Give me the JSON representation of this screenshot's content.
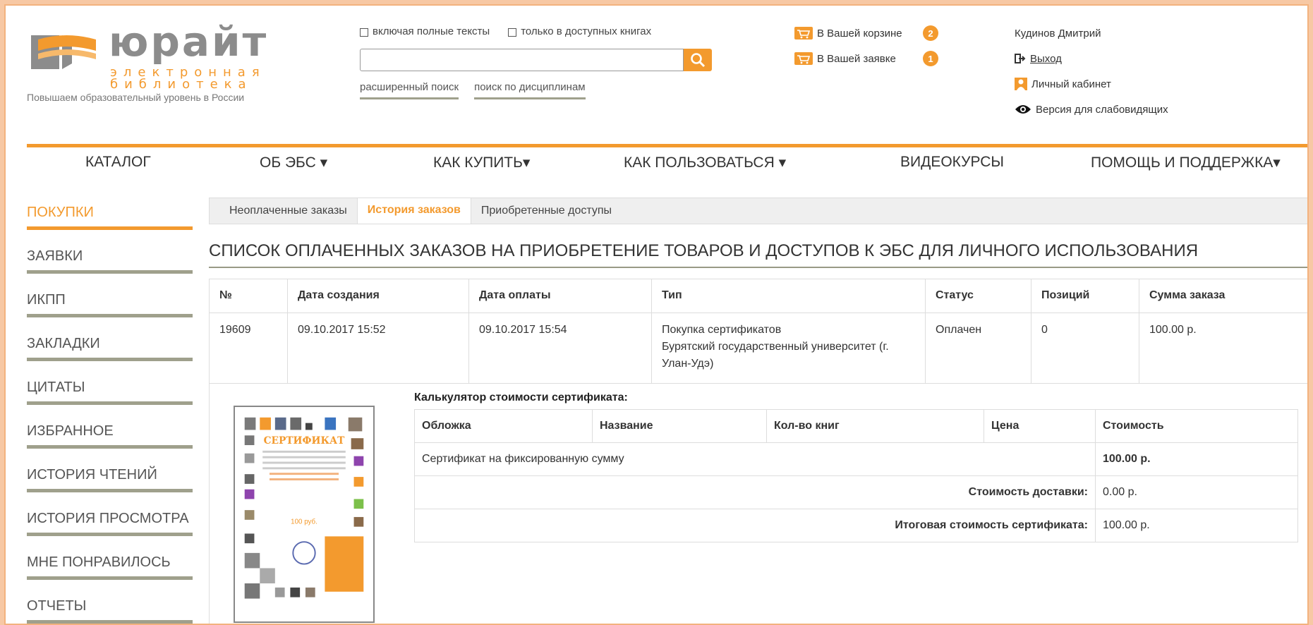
{
  "header": {
    "logo_word": "юрайт",
    "logo_sub_line1": "электронная",
    "logo_sub_line2": "библиотека",
    "tagline": "Повышаем образовательный уровень в России"
  },
  "search": {
    "check_full_texts": "включая полные тексты",
    "check_available": "только в доступных книгах",
    "placeholder": "",
    "advanced_link": "расширенный поиск",
    "discipline_link": "поиск по дисциплинам"
  },
  "basket": {
    "cart_label": "В Вашей корзине",
    "cart_count": "2",
    "request_label": "В Вашей заявке",
    "request_count": "1"
  },
  "user": {
    "name": "Кудинов Дмитрий",
    "logout": "Выход",
    "cabinet": "Личный кабинет",
    "low_vision": "Версия для слабовидящих"
  },
  "nav": {
    "catalog": "КАТАЛОГ",
    "about": "ОБ ЭБС ▾",
    "how_buy": "КАК КУПИТЬ▾",
    "how_use": "КАК ПОЛЬЗОВАТЬСЯ ▾",
    "video": "ВИДЕОКУРСЫ",
    "help": "ПОМОЩЬ И ПОДДЕРЖКА▾"
  },
  "sidebar": {
    "items": [
      "ПОКУПКИ",
      "ЗАЯВКИ",
      "ИКПП",
      "ЗАКЛАДКИ",
      "ЦИТАТЫ",
      "ИЗБРАННОЕ",
      "ИСТОРИЯ ЧТЕНИЙ",
      "ИСТОРИЯ ПРОСМОТРА",
      "МНЕ ПОНРАВИЛОСЬ",
      "ОТЧЕТЫ"
    ]
  },
  "tabs": {
    "unpaid": "Неоплаченные заказы",
    "history": "История заказов",
    "acquired": "Приобретенные доступы"
  },
  "page_title": "СПИСОК ОПЛАЧЕННЫХ ЗАКАЗОВ НА ПРИОБРЕТЕНИЕ ТОВАРОВ И ДОСТУПОВ К ЭБС ДЛЯ ЛИЧНОГО ИСПОЛЬЗОВАНИЯ",
  "orders": {
    "headers": [
      "№",
      "Дата создания",
      "Дата оплаты",
      "Тип",
      "Статус",
      "Позиций",
      "Сумма заказа"
    ],
    "row": {
      "number": "19609",
      "created": "09.10.2017 15:52",
      "paid": "09.10.2017 15:54",
      "type_line1": "Покупка сертификатов",
      "type_line2": "Бурятский государственный университет (г. Улан-Удэ)",
      "status": "Оплачен",
      "positions": "0",
      "sum": "100.00 р."
    }
  },
  "calculator": {
    "title": "Калькулятор стоимости сертификата:",
    "headers": [
      "Обложка",
      "Название",
      "Кол-во книг",
      "Цена",
      "Стоимость"
    ],
    "item_name": "Сертификат на фиксированную сумму",
    "item_cost": "100.00 р.",
    "delivery_label": "Стоимость доставки:",
    "delivery_value": "0.00 р.",
    "total_label": "Итоговая стоимость сертификата:",
    "total_value": "100.00 р."
  },
  "certificate": {
    "heading": "СЕРТИФИКАТ",
    "amount": "100 руб."
  },
  "colors": {
    "accent": "#f39a2e",
    "underline": "#9fa08c"
  }
}
